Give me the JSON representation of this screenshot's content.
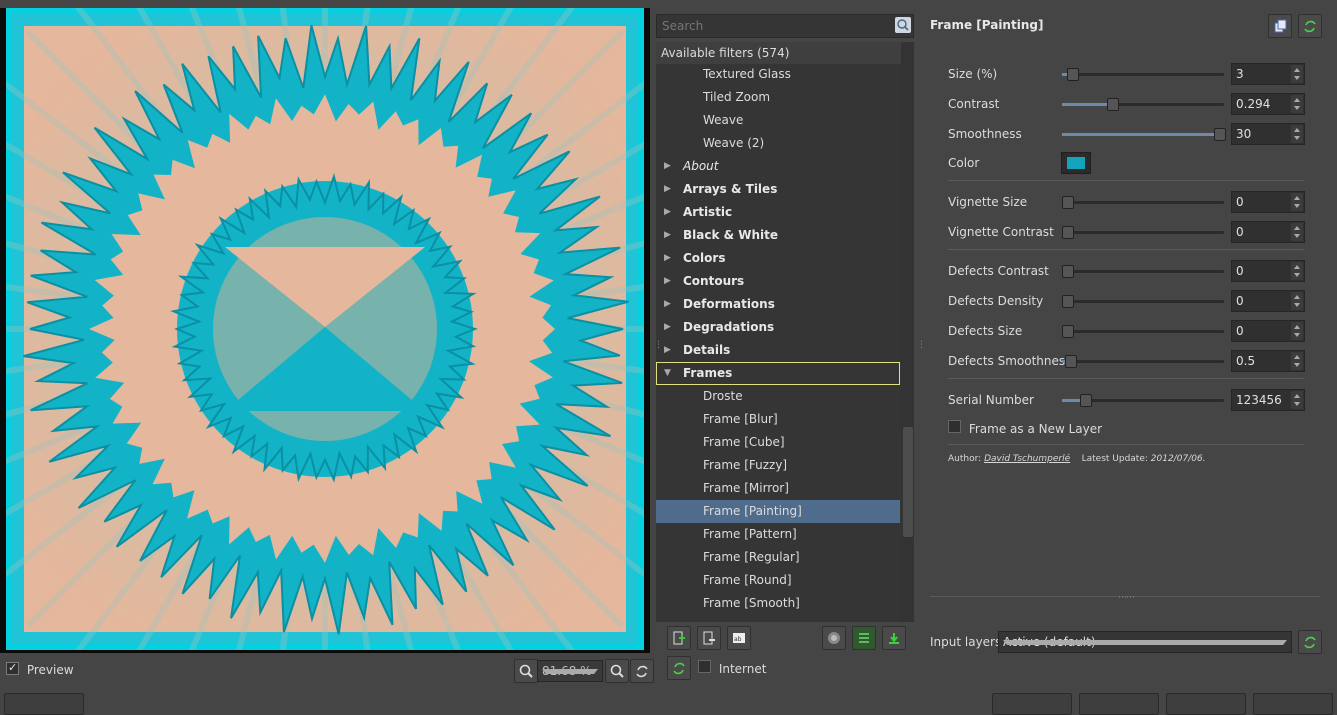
{
  "preview_panel": {
    "preview_label": "Preview",
    "preview_checked": true,
    "zoom": "81.68 %"
  },
  "filters": {
    "search_placeholder": "Search",
    "header": "Available filters (574)",
    "rows": [
      {
        "label": "Textured Glass",
        "kind": "leaf"
      },
      {
        "label": "Tiled Zoom",
        "kind": "leaf"
      },
      {
        "label": "Weave",
        "kind": "leaf"
      },
      {
        "label": "Weave (2)",
        "kind": "leaf"
      },
      {
        "label": "About",
        "kind": "cat-italic"
      },
      {
        "label": "Arrays & Tiles",
        "kind": "cat"
      },
      {
        "label": "Artistic",
        "kind": "cat"
      },
      {
        "label": "Black & White",
        "kind": "cat"
      },
      {
        "label": "Colors",
        "kind": "cat"
      },
      {
        "label": "Contours",
        "kind": "cat"
      },
      {
        "label": "Deformations",
        "kind": "cat"
      },
      {
        "label": "Degradations",
        "kind": "cat"
      },
      {
        "label": "Details",
        "kind": "cat"
      },
      {
        "label": "Frames",
        "kind": "cat-open"
      },
      {
        "label": "Droste",
        "kind": "leaf"
      },
      {
        "label": "Frame [Blur]",
        "kind": "leaf"
      },
      {
        "label": "Frame [Cube]",
        "kind": "leaf"
      },
      {
        "label": "Frame [Fuzzy]",
        "kind": "leaf"
      },
      {
        "label": "Frame [Mirror]",
        "kind": "leaf"
      },
      {
        "label": "Frame [Painting]",
        "kind": "leaf-selected"
      },
      {
        "label": "Frame [Pattern]",
        "kind": "leaf"
      },
      {
        "label": "Frame [Regular]",
        "kind": "leaf"
      },
      {
        "label": "Frame [Round]",
        "kind": "leaf"
      },
      {
        "label": "Frame [Smooth]",
        "kind": "leaf"
      }
    ],
    "internet_label": "Internet",
    "internet_checked": false
  },
  "params": {
    "title": "Frame [Painting]",
    "size_label": "Size (%)",
    "size_value": "3",
    "size_level": 0.03,
    "contrast_label": "Contrast",
    "contrast_value": "0.294",
    "contrast_level": 0.294,
    "smoothness_label": "Smoothness",
    "smoothness_value": "30",
    "smoothness_level": 1.0,
    "color_label": "Color",
    "color_value": "#13a3bc",
    "vignette_size_label": "Vignette Size",
    "vignette_size_value": "0",
    "vignette_size_level": 0,
    "vignette_contrast_label": "Vignette Contrast",
    "vignette_contrast_value": "0",
    "vignette_contrast_level": 0,
    "defects_contrast_label": "Defects Contrast",
    "defects_contrast_value": "0",
    "defects_contrast_level": 0,
    "defects_density_label": "Defects Density",
    "defects_density_value": "0",
    "defects_density_level": 0,
    "defects_size_label": "Defects Size",
    "defects_size_value": "0",
    "defects_size_level": 0,
    "defects_smoothness_label": "Defects Smoothness",
    "defects_smoothness_value": "0.5",
    "defects_smoothness_level": 0.02,
    "serial_label": "Serial Number",
    "serial_value": "123456",
    "serial_level": 0.12,
    "new_layer_label": "Frame as a New Layer",
    "new_layer_checked": false,
    "author_prefix": "Author:",
    "author_name": "David Tschumperlé",
    "update_prefix": "Latest Update:",
    "update_date": "2012/07/06."
  },
  "input_layers": {
    "label": "Input layers",
    "value": "Active (default)"
  },
  "colors": {
    "accent_teal": "#13b4c8",
    "peach": "#e5b79c",
    "selection": "#4f6c8c"
  }
}
